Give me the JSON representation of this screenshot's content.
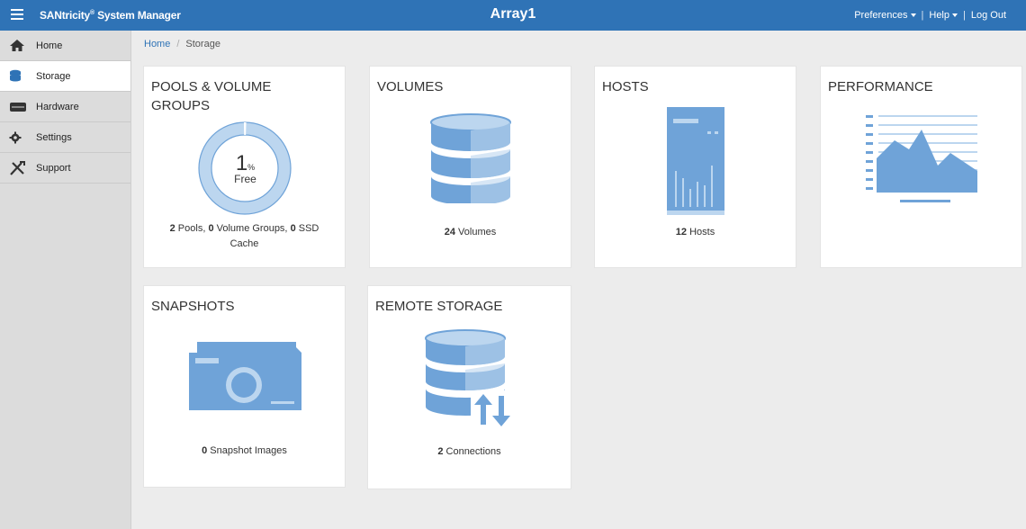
{
  "header": {
    "app_name": "SANtricity",
    "app_mark": "®",
    "app_suffix": " System Manager",
    "array_name": "Array1",
    "preferences_label": "Preferences",
    "help_label": "Help",
    "logout_label": "Log Out",
    "separator": "|",
    "menu_icon": "hamburger-menu-icon"
  },
  "sidebar": {
    "items": [
      {
        "label": "Home",
        "icon": "home-icon",
        "active": false
      },
      {
        "label": "Storage",
        "icon": "database-icon",
        "active": true
      },
      {
        "label": "Hardware",
        "icon": "hardware-icon",
        "active": false
      },
      {
        "label": "Settings",
        "icon": "gear-icon",
        "active": false
      },
      {
        "label": "Support",
        "icon": "tools-icon",
        "active": false
      }
    ]
  },
  "breadcrumb": {
    "home": "Home",
    "separator": "/",
    "current": "Storage"
  },
  "tiles": {
    "pools": {
      "title": "POOLS & VOLUME GROUPS",
      "free_value": "1",
      "free_unit": "%",
      "free_label": "Free",
      "free_fraction": 0.01,
      "pools_count": "2",
      "pools_text": " Pools, ",
      "vg_count": "0",
      "vg_text": " Volume Groups, ",
      "ssd_count": "0",
      "ssd_text": " SSD Cache"
    },
    "volumes": {
      "title": "VOLUMES",
      "count": "24",
      "text": " Volumes"
    },
    "hosts": {
      "title": "HOSTS",
      "count": "12",
      "text": " Hosts"
    },
    "performance": {
      "title": "PERFORMANCE"
    },
    "snapshots": {
      "title": "SNAPSHOTS",
      "count": "0",
      "text": " Snapshot Images"
    },
    "remote": {
      "title": "REMOTE STORAGE",
      "count": "2",
      "text": " Connections"
    }
  },
  "colors": {
    "header_blue": "#2f73b6",
    "icon_blue": "#6fa3d8",
    "icon_light": "#bcd6ef",
    "sidebar_gray": "#dcdcdc"
  }
}
